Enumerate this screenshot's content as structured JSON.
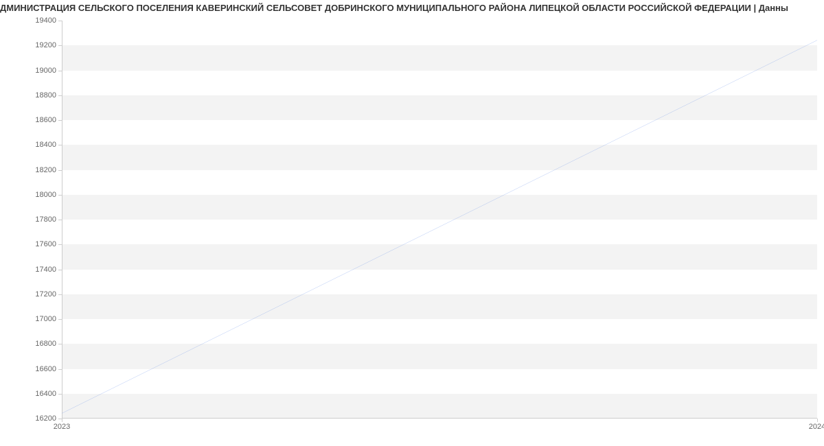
{
  "chart_data": {
    "type": "line",
    "title": "ДМИНИСТРАЦИЯ СЕЛЬСКОГО ПОСЕЛЕНИЯ КАВЕРИНСКИЙ СЕЛЬСОВЕТ ДОБРИНСКОГО МУНИЦИПАЛЬНОГО РАЙОНА ЛИПЕЦКОЙ ОБЛАСТИ РОССИЙСКОЙ ФЕДЕРАЦИИ | Данны",
    "x": [
      2023,
      2024
    ],
    "series": [
      {
        "name": "",
        "values": [
          16242,
          19242
        ],
        "color": "#6f94e8"
      }
    ],
    "xlabel": "",
    "ylabel": "",
    "x_ticks": [
      2023,
      2024
    ],
    "y_ticks": [
      16200,
      16400,
      16600,
      16800,
      17000,
      17200,
      17400,
      17600,
      17800,
      18000,
      18200,
      18400,
      18600,
      18800,
      19000,
      19200,
      19400
    ],
    "ylim": [
      16200,
      19400
    ],
    "xlim": [
      2023,
      2024
    ],
    "grid_bands": true
  }
}
